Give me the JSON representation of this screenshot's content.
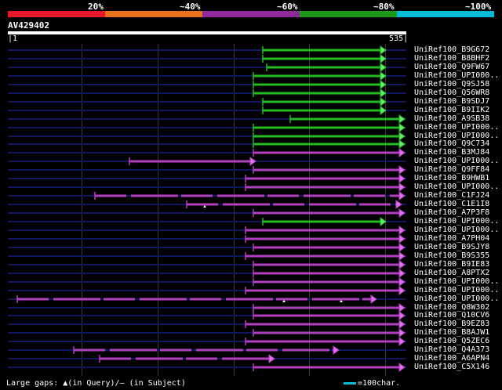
{
  "legend": {
    "labels": [
      "20%",
      "~40%",
      "~60%",
      "~80%",
      "~100%"
    ],
    "segments": [
      {
        "color": "#e8192c"
      },
      {
        "color": "#e8711a"
      },
      {
        "color": "#8e2a9c"
      },
      {
        "color": "#1a9c1a"
      },
      {
        "color": "#00bcd4"
      }
    ]
  },
  "query": {
    "id": "AV429402",
    "start": "1",
    "end": "535"
  },
  "colors": {
    "purple": "#b040c0",
    "green": "#22bb22",
    "purple_head": "#e070f0",
    "green_head": "#66ee66",
    "track": "#101860"
  },
  "hits": [
    {
      "label": "UniRef100_B9G672",
      "start": 335,
      "end": 492,
      "color": "green"
    },
    {
      "label": "UniRef100_B8BHF2",
      "start": 335,
      "end": 492,
      "color": "green"
    },
    {
      "label": "UniRef100_Q9FW67",
      "start": 340,
      "end": 492,
      "color": "green"
    },
    {
      "label": "UniRef100_UPI000..",
      "start": 323,
      "end": 492,
      "color": "green"
    },
    {
      "label": "UniRef100_Q9SJ58",
      "start": 323,
      "end": 492,
      "color": "green"
    },
    {
      "label": "UniRef100_Q56WR8",
      "start": 323,
      "end": 492,
      "color": "green"
    },
    {
      "label": "UniRef100_B9SDJ7",
      "start": 335,
      "end": 492,
      "color": "green"
    },
    {
      "label": "UniRef100_B9IIK2",
      "start": 335,
      "end": 492,
      "color": "green"
    },
    {
      "label": "UniRef100_A9SB38",
      "start": 370,
      "end": 516,
      "color": "green"
    },
    {
      "label": "UniRef100_UPI000..",
      "start": 323,
      "end": 516,
      "color": "green"
    },
    {
      "label": "UniRef100_UPI000..",
      "start": 323,
      "end": 516,
      "color": "green"
    },
    {
      "label": "UniRef100_Q9C734",
      "start": 323,
      "end": 516,
      "color": "green"
    },
    {
      "label": "UniRef100_B3MJ84",
      "start": 323,
      "end": 516,
      "color": "purple"
    },
    {
      "label": "UniRef100_UPI000..",
      "start": 165,
      "end": 326,
      "color": "purple"
    },
    {
      "label": "UniRef100_Q9FF84",
      "start": 323,
      "end": 516,
      "color": "purple"
    },
    {
      "label": "UniRef100_B9HWB1",
      "start": 313,
      "end": 516,
      "color": "purple"
    },
    {
      "label": "UniRef100_UPI000..",
      "start": 313,
      "end": 516,
      "color": "purple"
    },
    {
      "label": "UniRef100_C1FJ24",
      "start": 121,
      "end": 516,
      "color": "purple",
      "gap": true
    },
    {
      "label": "UniRef100_C1E1I8",
      "start": 238,
      "end": 512,
      "color": "purple",
      "gap": true,
      "mark": 261
    },
    {
      "label": "UniRef100_A7P3F8",
      "start": 323,
      "end": 516,
      "color": "purple"
    },
    {
      "label": "UniRef100_UPI000..",
      "start": 335,
      "end": 492,
      "color": "green"
    },
    {
      "label": "UniRef100_UPI000..",
      "start": 313,
      "end": 516,
      "color": "purple"
    },
    {
      "label": "UniRef100_A7PH04",
      "start": 313,
      "end": 516,
      "color": "purple"
    },
    {
      "label": "UniRef100_B9SJY8",
      "start": 323,
      "end": 516,
      "color": "purple"
    },
    {
      "label": "UniRef100_B9S355",
      "start": 313,
      "end": 516,
      "color": "purple"
    },
    {
      "label": "UniRef100_B9IE83",
      "start": 323,
      "end": 516,
      "color": "purple"
    },
    {
      "label": "UniRef100_A8PTX2",
      "start": 323,
      "end": 516,
      "color": "purple"
    },
    {
      "label": "UniRef100_UPI000..",
      "start": 323,
      "end": 516,
      "color": "purple"
    },
    {
      "label": "UniRef100_UPI000..",
      "start": 313,
      "end": 516,
      "color": "purple"
    },
    {
      "label": "UniRef100_UPI000..",
      "start": 22,
      "end": 480,
      "color": "purple",
      "gap": true,
      "mark": 362,
      "mark2": 435
    },
    {
      "label": "UniRef100_Q8W302",
      "start": 323,
      "end": 516,
      "color": "purple"
    },
    {
      "label": "UniRef100_Q10CV6",
      "start": 323,
      "end": 516,
      "color": "purple"
    },
    {
      "label": "UniRef100_B9EZ83",
      "start": 313,
      "end": 516,
      "color": "purple"
    },
    {
      "label": "UniRef100_B8AJW1",
      "start": 323,
      "end": 516,
      "color": "purple"
    },
    {
      "label": "UniRef100_Q5ZEC6",
      "start": 313,
      "end": 516,
      "color": "purple"
    },
    {
      "label": "UniRef100_Q4A373",
      "start": 94,
      "end": 432,
      "color": "purple",
      "gap": true
    },
    {
      "label": "UniRef100_A6APN4",
      "start": 127,
      "end": 350,
      "color": "purple",
      "gap": true
    },
    {
      "label": "UniRef100_C5X146",
      "start": 323,
      "end": 516,
      "color": "purple"
    }
  ],
  "footer": {
    "large_gaps": "Large gaps:",
    "gap_in_query": "(in Query)/",
    "gap_in_subject": "(in Subject)",
    "scale": "=100char."
  }
}
